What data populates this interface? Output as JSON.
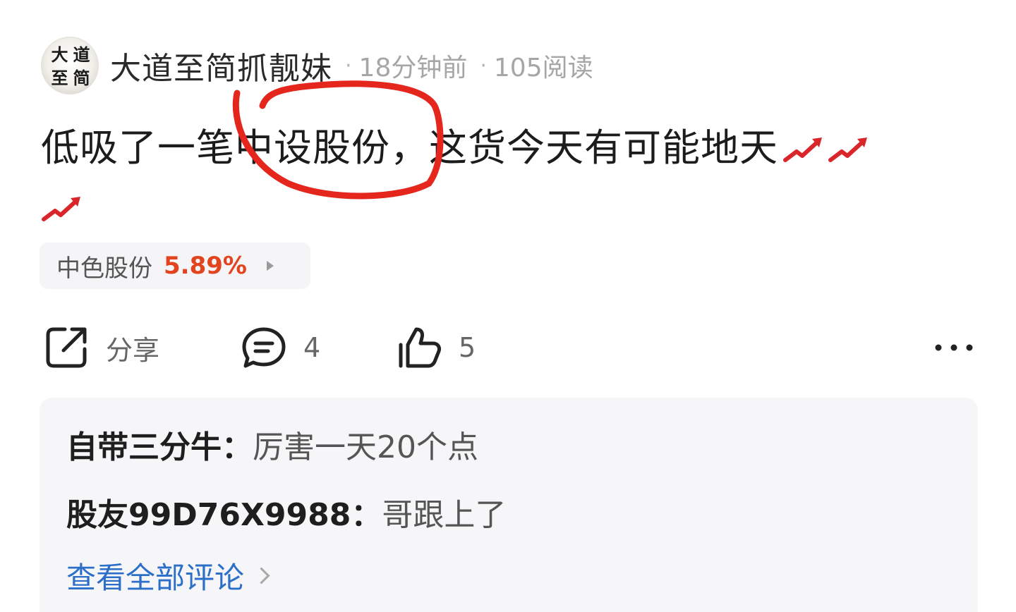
{
  "header": {
    "avatar_chars": [
      "大",
      "道",
      "至",
      "简"
    ],
    "username": "大道至简抓靓妹",
    "time_ago": "18分钟前",
    "reads": "105阅读"
  },
  "post": {
    "text_line1": "低吸了一笔中设股份，这货今天有可能地天",
    "emoji": "chart-increasing-icon"
  },
  "stock_tag": {
    "name": "中色股份",
    "change": "5.89%",
    "change_color": "#e2441f"
  },
  "actions": {
    "share_label": "分享",
    "comment_count": "4",
    "like_count": "5"
  },
  "comments": [
    {
      "author": "自带三分牛：",
      "text": "厉害一天20个点"
    },
    {
      "author": "股友99D76X9988：",
      "text": "哥跟上了"
    }
  ],
  "view_all_label": "查看全部评论",
  "colors": {
    "annotation": "#e4261c",
    "link": "#2b6fc9"
  }
}
